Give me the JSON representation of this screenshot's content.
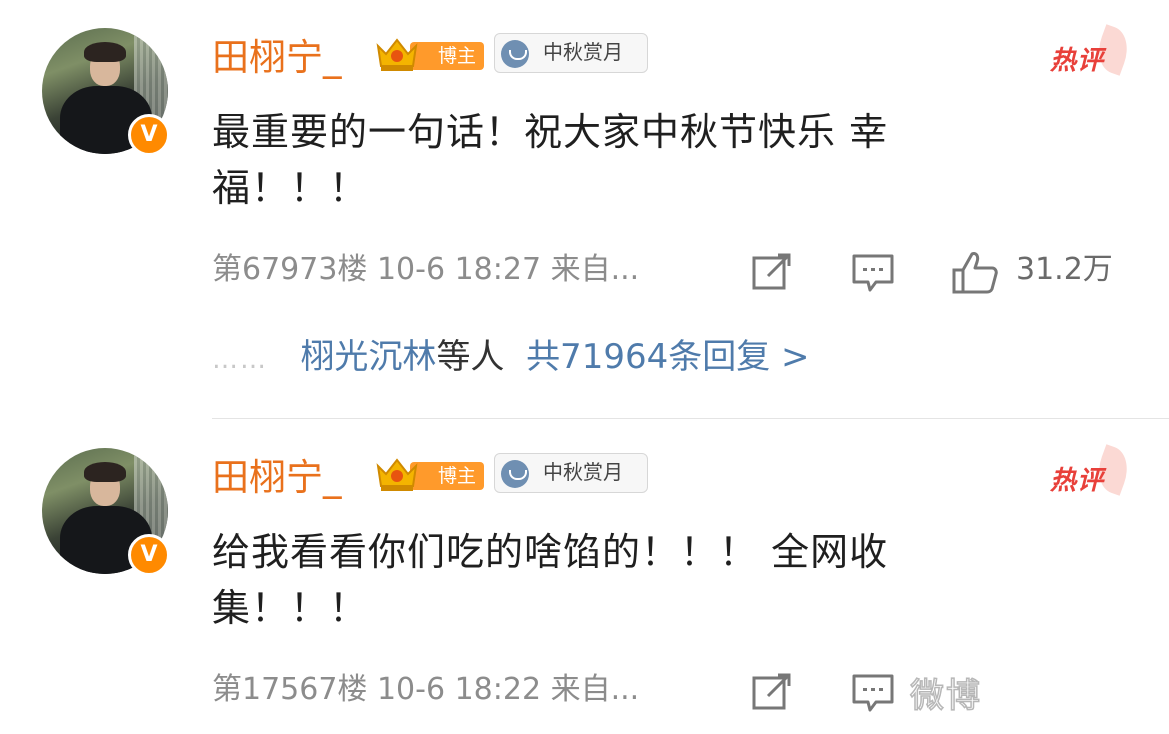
{
  "comments": [
    {
      "username": "田栩宁_",
      "host_badge": "博主",
      "event_badge": "中秋赏月",
      "hot_label": "热评",
      "verified_mark": "V",
      "text": "最重要的一句话！祝大家中秋节快乐 幸福！！！",
      "meta": "第67973楼 10-6 18:27 来自...",
      "likes": "31.2万",
      "replies": {
        "dots": "……",
        "names": "栩光沉林",
        "suffix": "等人",
        "total": "共71964条回复 >"
      }
    },
    {
      "username": "田栩宁_",
      "host_badge": "博主",
      "event_badge": "中秋赏月",
      "hot_label": "热评",
      "verified_mark": "V",
      "text": "给我看看你们吃的啥馅的！！！ 全网收集！！！",
      "meta": "第17567楼 10-6 18:22 来自..."
    }
  ],
  "watermark": "微博"
}
